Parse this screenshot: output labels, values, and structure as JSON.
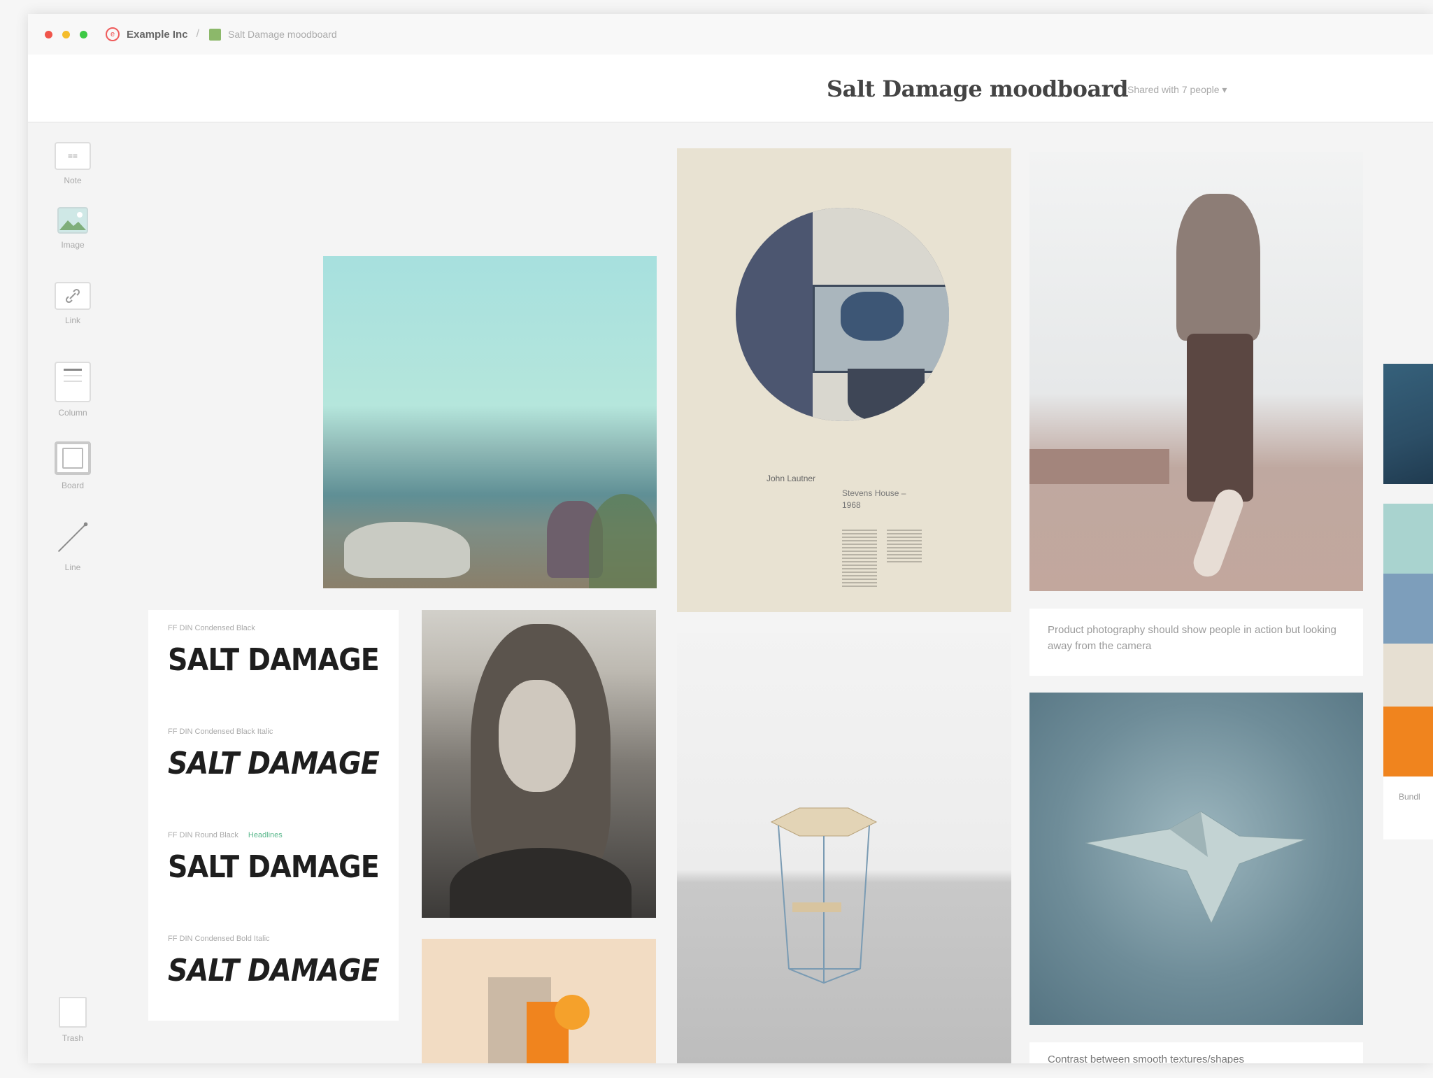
{
  "browser": {
    "org_icon": "e",
    "org_name": "Example Inc",
    "separator": "/",
    "board_name": "Salt Damage moodboard"
  },
  "header": {
    "title": "Salt Damage moodboard",
    "share_label": "Shared with 7 people ▾"
  },
  "toolbar": {
    "items": [
      {
        "icon": "note-icon",
        "label": "Note",
        "glyph": "≡≡"
      },
      {
        "icon": "image-icon",
        "label": "Image",
        "glyph": ""
      },
      {
        "icon": "link-icon",
        "label": "Link",
        "glyph": "🔗"
      },
      {
        "icon": "column-icon",
        "label": "Column",
        "glyph": ""
      },
      {
        "icon": "board-icon",
        "label": "Board",
        "glyph": ""
      },
      {
        "icon": "line-icon",
        "label": "Line",
        "glyph": ""
      }
    ],
    "trash_label": "Trash"
  },
  "fonts_card": {
    "rows": [
      {
        "meta": "FF DIN Condensed Black",
        "sample": "SALT DAMAGE",
        "tag": ""
      },
      {
        "meta": "FF DIN Condensed Black Italic",
        "sample": "SALT DAMAGE",
        "tag": ""
      },
      {
        "meta": "FF DIN Round Black",
        "sample": "SALT DAMAGE",
        "tag": "Headlines"
      },
      {
        "meta": "FF DIN Condensed Bold Italic",
        "sample": "SALT DAMAGE",
        "tag": ""
      }
    ]
  },
  "poster": {
    "name": "John Lautner",
    "subtitle": "Stevens House – 1968"
  },
  "notes": {
    "skate": "Product photography should show people in action but looking away from the camera",
    "contrast": "Contrast between smooth textures/shapes",
    "palette_label": "Bundl"
  },
  "colors": {
    "accent_orange": "#f0841e",
    "palette": [
      "#a9d3cf",
      "#7d9ebb",
      "#e6dfd2",
      "#f0841e"
    ]
  }
}
